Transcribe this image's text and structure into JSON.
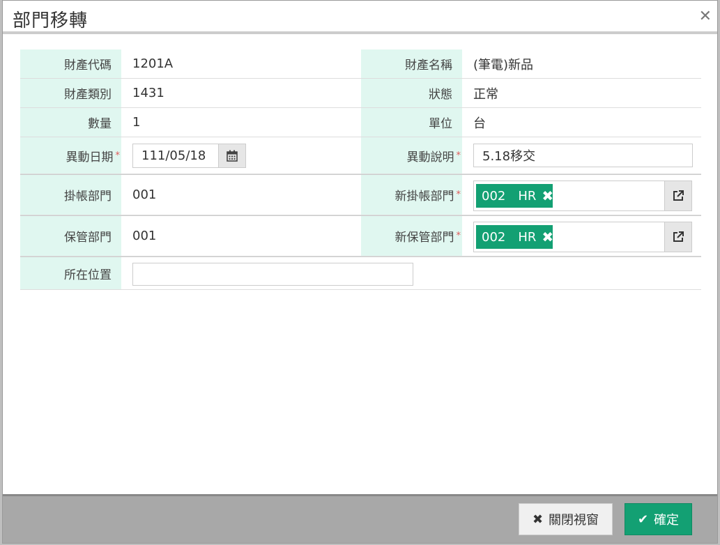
{
  "dialog": {
    "title": "部門移轉",
    "close_symbol": "✕"
  },
  "fields": {
    "property_code": {
      "label": "財產代碼",
      "value": "1201A"
    },
    "property_name": {
      "label": "財產名稱",
      "value": "(筆電)新品"
    },
    "property_category": {
      "label": "財產類別",
      "value": "1431"
    },
    "status": {
      "label": "狀態",
      "value": "正常"
    },
    "quantity": {
      "label": "數量",
      "value": "1"
    },
    "unit": {
      "label": "單位",
      "value": "台"
    },
    "change_date": {
      "label": "異動日期",
      "value": "111/05/18",
      "required_mark": "*"
    },
    "change_note": {
      "label": "異動說明",
      "value": "5.18移交",
      "required_mark": "*"
    },
    "account_dept": {
      "label": "掛帳部門",
      "value": "001"
    },
    "new_account_dept": {
      "label": "新掛帳部門",
      "tag_code": "002",
      "tag_name": "HR",
      "required_mark": "*"
    },
    "custody_dept": {
      "label": "保管部門",
      "value": "001"
    },
    "new_custody_dept": {
      "label": "新保管部門",
      "tag_code": "002",
      "tag_name": "HR",
      "required_mark": "*"
    },
    "location": {
      "label": "所在位置",
      "value": ""
    }
  },
  "footer": {
    "close_label": "關閉視窗",
    "confirm_label": "確定"
  },
  "colors": {
    "label_bg": "#e0f7f0",
    "accent_green": "#13a073",
    "footer_bg": "#a8a8a8",
    "required": "#e05a5a"
  },
  "icons": {
    "calendar": "calendar-icon",
    "external": "external-link-icon",
    "remove": "remove-tag-icon",
    "close": "close-icon",
    "check": "check-icon"
  }
}
